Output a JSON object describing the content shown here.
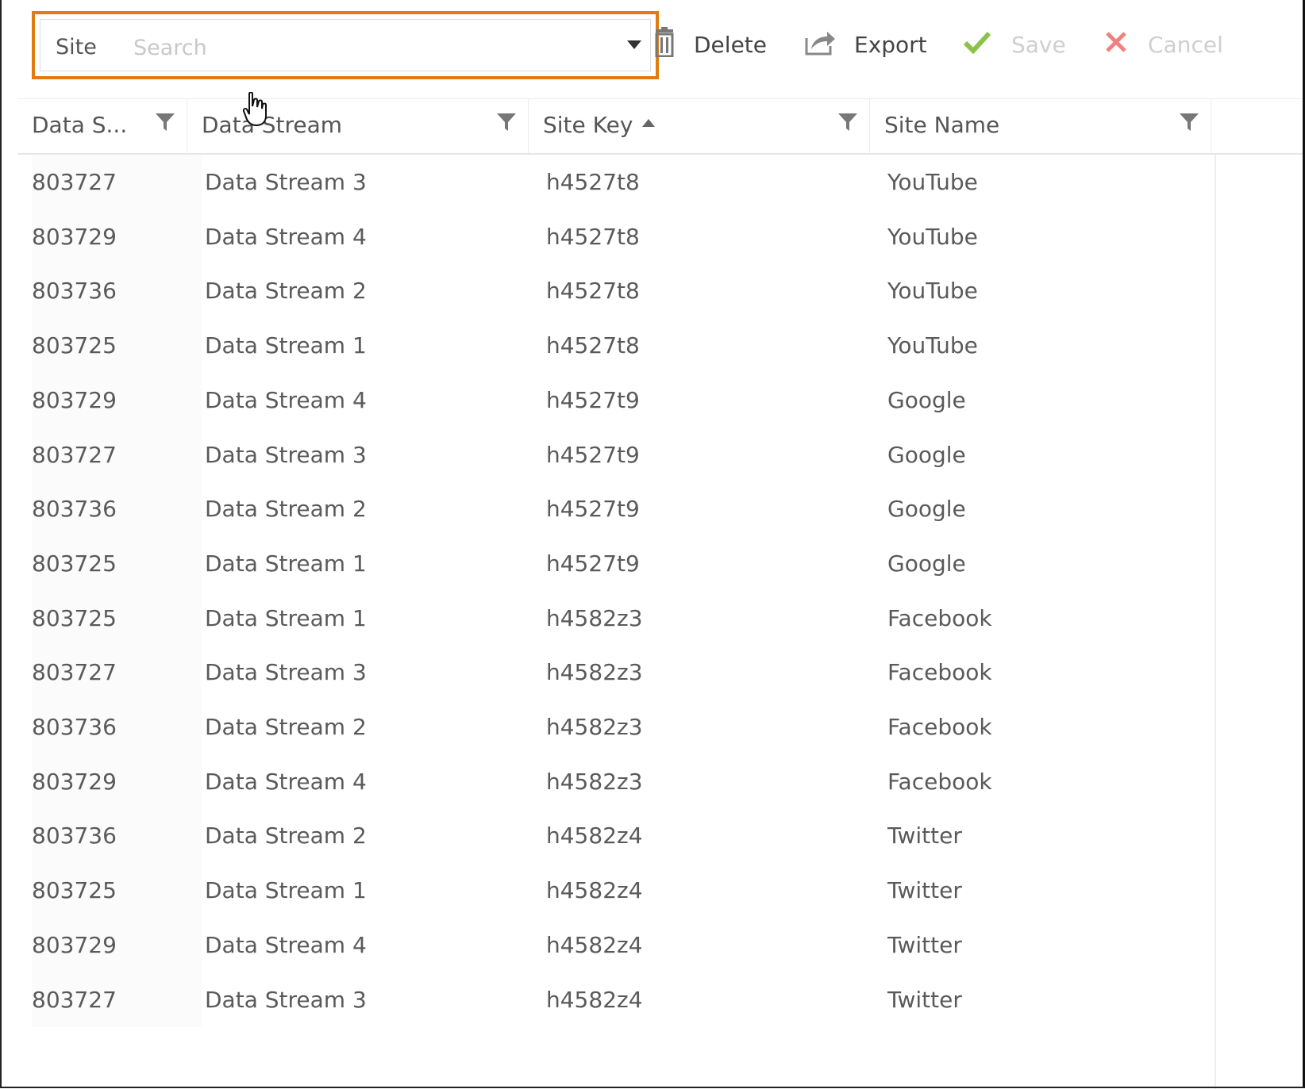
{
  "toolbar": {
    "site_label": "Site",
    "site_placeholder": "Search",
    "delete_label": "Delete",
    "export_label": "Export",
    "save_label": "Save",
    "cancel_label": "Cancel",
    "accent_color": "#e07c12",
    "save_icon_color": "#8bc34a",
    "cancel_icon_color": "#f08080"
  },
  "grid": {
    "columns": [
      {
        "label": "Data S...",
        "sort": null,
        "filter": true
      },
      {
        "label": "Data Stream",
        "sort": null,
        "filter": true
      },
      {
        "label": "Site Key",
        "sort": "ascending",
        "filter": true
      },
      {
        "label": "Site Name",
        "sort": null,
        "filter": true
      }
    ],
    "rows": [
      [
        "803727",
        "Data Stream 3",
        "h4527t8",
        "YouTube"
      ],
      [
        "803729",
        "Data Stream 4",
        "h4527t8",
        "YouTube"
      ],
      [
        "803736",
        "Data Stream 2",
        "h4527t8",
        "YouTube"
      ],
      [
        "803725",
        "Data Stream 1",
        "h4527t8",
        "YouTube"
      ],
      [
        "803729",
        "Data Stream 4",
        "h4527t9",
        "Google"
      ],
      [
        "803727",
        "Data Stream 3",
        "h4527t9",
        "Google"
      ],
      [
        "803736",
        "Data Stream 2",
        "h4527t9",
        "Google"
      ],
      [
        "803725",
        "Data Stream 1",
        "h4527t9",
        "Google"
      ],
      [
        "803725",
        "Data Stream 1",
        "h4582z3",
        "Facebook"
      ],
      [
        "803727",
        "Data Stream 3",
        "h4582z3",
        "Facebook"
      ],
      [
        "803736",
        "Data Stream 2",
        "h4582z3",
        "Facebook"
      ],
      [
        "803729",
        "Data Stream 4",
        "h4582z3",
        "Facebook"
      ],
      [
        "803736",
        "Data Stream 2",
        "h4582z4",
        "Twitter"
      ],
      [
        "803725",
        "Data Stream 1",
        "h4582z4",
        "Twitter"
      ],
      [
        "803729",
        "Data Stream 4",
        "h4582z4",
        "Twitter"
      ],
      [
        "803727",
        "Data Stream 3",
        "h4582z4",
        "Twitter"
      ]
    ]
  }
}
